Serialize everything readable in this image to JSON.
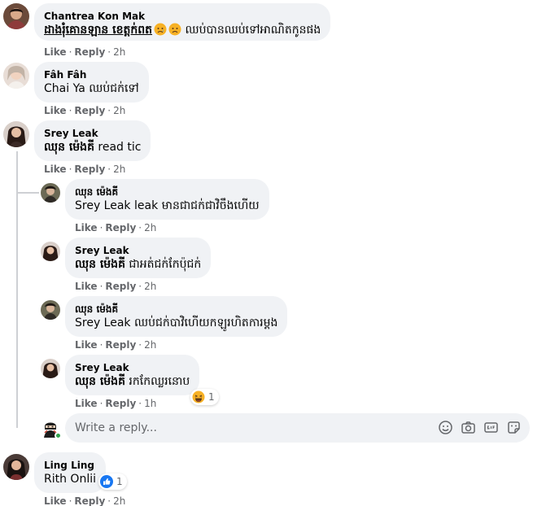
{
  "comments": [
    {
      "author": "Chantrea Kon Mak",
      "mention": "ដាងរុំគោនឡាន ខេត្តក់ពត",
      "text": " ឈប់បានឈប់ទៅអាណិតកូនផង",
      "like": "Like",
      "reply": "Reply",
      "time": "2h",
      "avatar_color": "#6b4a3a"
    },
    {
      "author": "Fâh Fâh",
      "mention": "Chai Ya",
      "text": " ឈប់ជក់ទៅ",
      "like": "Like",
      "reply": "Reply",
      "time": "2h",
      "avatar_color": "#c9b6a8"
    },
    {
      "author": "Srey Leak",
      "mention": "ឈុន ម៉េងគី",
      "text": " read tic",
      "like": "Like",
      "reply": "Reply",
      "time": "2h",
      "avatar_color": "#3b2a26"
    }
  ],
  "replies": [
    {
      "author": "ឈុន ម៉េងគី",
      "mention": "Srey Leak",
      "text": " leak មានជាជក់ជាវិចឹងហើយ",
      "like": "Like",
      "reply": "Reply",
      "time": "2h",
      "avatar_color": "#4a4038"
    },
    {
      "author": "Srey Leak",
      "mention": "ឈុន ម៉េងគី",
      "text": " ជាអត់ជក់កែប៉ុជក់",
      "like": "Like",
      "reply": "Reply",
      "time": "2h",
      "avatar_color": "#3b2a26"
    },
    {
      "author": "ឈុន ម៉េងគី",
      "mention": "Srey Leak",
      "text": " ឈប់ជក់បាវិហើយកឡូរហិតការម្តង",
      "like": "Like",
      "reply": "Reply",
      "time": "2h",
      "avatar_color": "#4a4038"
    },
    {
      "author": "Srey Leak",
      "mention": "ឈុន ម៉េងគី",
      "text": " រកកែឈ្លរនោប",
      "like": "Like",
      "reply": "Reply",
      "time": "1h",
      "avatar_color": "#3b2a26",
      "reaction_count": "1"
    }
  ],
  "reply_box": {
    "placeholder": "Write a reply..."
  },
  "last_comment": {
    "author": "Ling Ling",
    "text": "Rith Onlii",
    "like": "Like",
    "reply": "Reply",
    "time": "2h",
    "avatar_color": "#2b1f1c",
    "reaction_count": "1"
  },
  "colors": {
    "bubble": "#f0f2f5",
    "meta": "#65676b",
    "like_blue": "#1877f2",
    "emoji_yellow": "#f7b125"
  },
  "icons": [
    "sad-emoji-icon",
    "laughing-emoji-icon",
    "like-reaction-icon",
    "emoji-icon",
    "camera-icon",
    "gif-icon",
    "sticker-icon",
    "online-dot-icon"
  ]
}
